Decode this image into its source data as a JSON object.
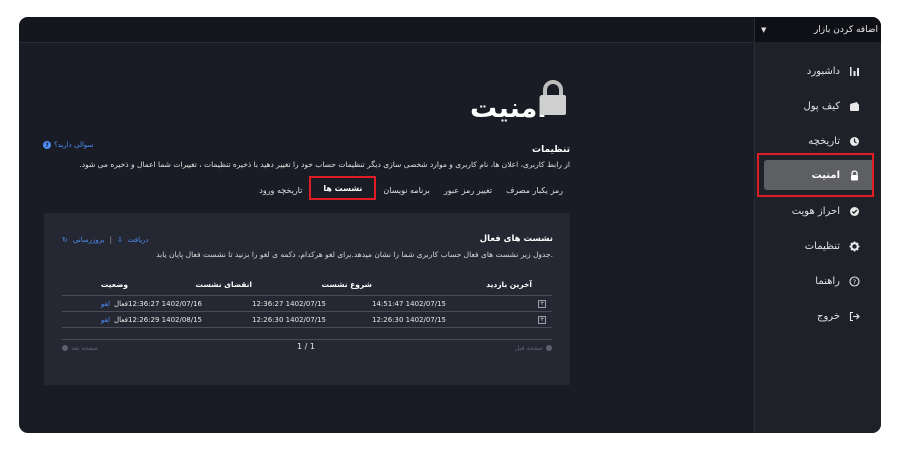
{
  "sidebar": {
    "market_select": "اضافه کردن بازار",
    "items": [
      {
        "label": "داشبورد",
        "icon": "bar-chart-icon"
      },
      {
        "label": "کیف پول",
        "icon": "wallet-icon"
      },
      {
        "label": "تاریخچه",
        "icon": "clock-icon"
      },
      {
        "label": "امنیت",
        "icon": "lock-icon"
      },
      {
        "label": "احراز هویت",
        "icon": "check-circle-icon"
      },
      {
        "label": "تنظیمات",
        "icon": "gear-icon"
      },
      {
        "label": "راهنما",
        "icon": "question-circle-icon"
      },
      {
        "label": "خروج",
        "icon": "logout-icon"
      }
    ],
    "active_index": 3
  },
  "page": {
    "title": "امنیت",
    "section_title": "تنظیمات",
    "help_link": "سوالی دارید؟",
    "section_desc": "از رابط کاربری، اعلان ها، نام کاربری و موارد شخصی سازی دیگر تنظیمات حساب خود را تغییر دهید با ذخیره تنظیمات ، تغییرات شما اعمال و ذخیره می شود."
  },
  "tabs": [
    {
      "label": "رمز یکبار مصرف",
      "active": false
    },
    {
      "label": "تغییر رمز عبور",
      "active": false
    },
    {
      "label": "برنامه نویسان",
      "active": false
    },
    {
      "label": "نشست ها",
      "active": true
    },
    {
      "label": "تاریخچه ورود",
      "active": false
    }
  ],
  "sessions": {
    "title": "نشست های فعال",
    "desc": "جدول زیر نشست های فعال حساب کاربری شما را نشان میدهد.برای لغو هرکدام، دکمه ی لغو را بزنید تا نشست فعال پایان یابد.",
    "download_label": "دریافت",
    "refresh_label": "بروزرسانی",
    "columns": {
      "last_visit": "آخرین بازدید",
      "start": "شروع نشست",
      "end": "انقضای نشست",
      "status": "وضعیت"
    },
    "rows": [
      {
        "last_visit": "14:51:47 1402/07/15",
        "start": "12:36:27 1402/07/15",
        "end": "12:36:27 1402/07/16",
        "status": "فعال",
        "cancel": "لغو"
      },
      {
        "last_visit": "12:26:30 1402/07/15",
        "start": "12:26:30 1402/07/15",
        "end": "12:26:29 1402/08/15",
        "status": "فعال",
        "cancel": "لغو"
      }
    ],
    "pager": {
      "prev": "صفحه قبل",
      "next": "صفحه بعد",
      "page": "1 / 1"
    }
  },
  "colors": {
    "accent_blue": "#4d8df6",
    "highlight_red": "#e01c24",
    "active_nav": "#5e5f63",
    "background": "#1a1c25"
  }
}
